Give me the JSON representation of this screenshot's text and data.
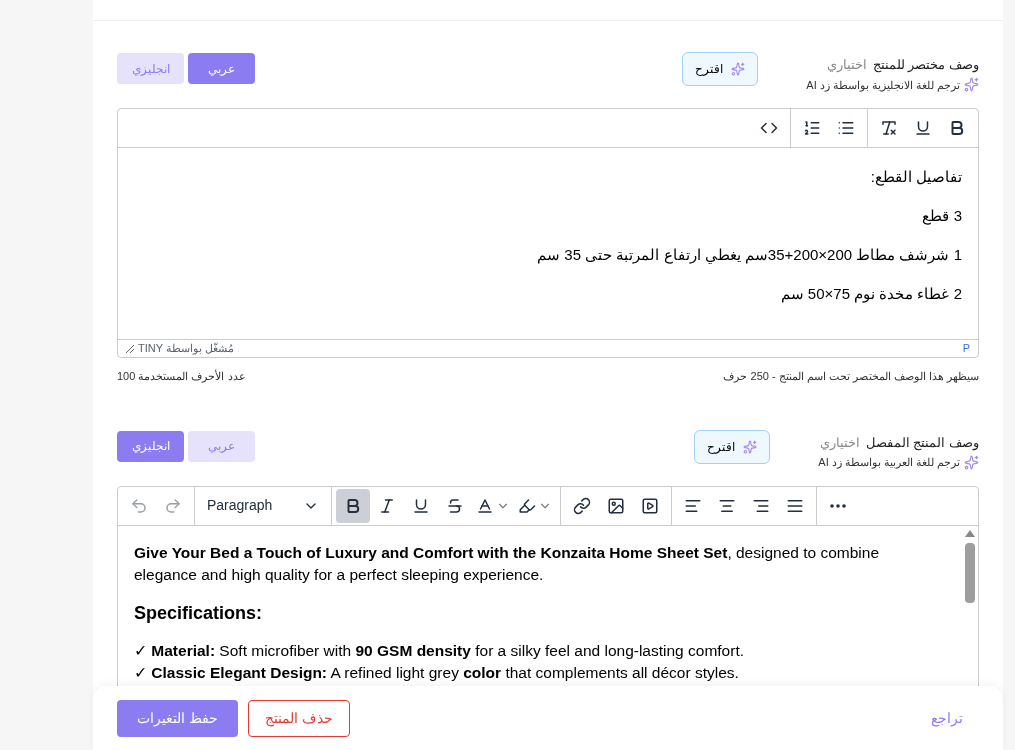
{
  "sections": [
    {
      "title": "وصف مختصر للمنتج",
      "optional": "اختياري",
      "translate": "ترجم للغة الانجليزية بواسطة زد AI",
      "suggest": "اقترح",
      "languages": [
        {
          "label": "عربي",
          "selected": true
        },
        {
          "label": "انجليزي",
          "selected": false
        }
      ],
      "editor": {
        "kind": "simple",
        "toolbar": [
          [
            {
              "kind": "bold"
            },
            {
              "kind": "underline"
            },
            {
              "kind": "clear-format"
            }
          ],
          [
            {
              "kind": "bullet-list"
            },
            {
              "kind": "numbered-list"
            }
          ],
          [
            {
              "kind": "code"
            }
          ]
        ],
        "blocks": [
          {
            "kind": "p",
            "text": "تفاصيل القطع:"
          },
          {
            "kind": "p",
            "text": "3 قطع"
          },
          {
            "kind": "p",
            "text": "1 شرشف مطاط 200×200+35سم يغطي ارتفاع المرتبة حتى 35 سم"
          },
          {
            "kind": "p",
            "text": "2 غطاء مخدة نوم 75×50 سم"
          }
        ],
        "path": "P",
        "branding": "مُشغّل بواسطة TINY"
      },
      "hint": "سيظهر هذا الوصف المختصر تحت اسم المنتج - 250 حرف",
      "count": "عدد الأحرف المستخدمة 100"
    },
    {
      "title": "وصف المنتج المفصل",
      "optional": "اختياري",
      "translate": "ترجم للغة العربية بواسطة زد AI",
      "suggest": "اقترح",
      "languages": [
        {
          "label": "عربي",
          "selected": false
        },
        {
          "label": "انجليزي",
          "selected": true
        }
      ],
      "editor": {
        "kind": "full",
        "block_format": "Paragraph",
        "toolbar": [
          [
            {
              "kind": "undo",
              "active": false
            },
            {
              "kind": "redo",
              "active": false
            }
          ],
          [
            {
              "kind": "format-select"
            }
          ],
          [
            {
              "kind": "bold",
              "active": true
            },
            {
              "kind": "italic",
              "active": false
            },
            {
              "kind": "underline",
              "active": false
            },
            {
              "kind": "strike",
              "active": false
            },
            {
              "kind": "text-color",
              "active": false
            },
            {
              "kind": "highlight",
              "active": false
            }
          ],
          [
            {
              "kind": "link",
              "active": false
            },
            {
              "kind": "image",
              "active": false
            },
            {
              "kind": "media",
              "active": false
            }
          ],
          [
            {
              "kind": "align-left",
              "active": false
            },
            {
              "kind": "align-center",
              "active": false
            },
            {
              "kind": "align-right",
              "active": false
            },
            {
              "kind": "align-justify",
              "active": false
            }
          ],
          [
            {
              "kind": "more",
              "active": false
            }
          ]
        ],
        "blocks": [
          {
            "kind": "p",
            "text": "**Give Your Bed a Touch of Luxury and Comfort with the Konzaita Home Sheet Set**, designed to combine elegance and high quality for a perfect sleeping experience."
          },
          {
            "kind": "h",
            "text": "Specifications:"
          },
          {
            "kind": "line",
            "text": "✓ **Material:** Soft microfiber with **90 GSM density** for a silky feel and long-lasting comfort."
          },
          {
            "kind": "line",
            "text": "✓ **Classic Elegant Design:** A refined light grey **color** that complements all décor styles."
          }
        ]
      }
    }
  ],
  "actions": [
    {
      "kind": "link",
      "label": "تراجع"
    },
    {
      "kind": "danger",
      "label": "حذف المنتج"
    },
    {
      "kind": "primary",
      "label": "حفظ التغيرات"
    }
  ]
}
